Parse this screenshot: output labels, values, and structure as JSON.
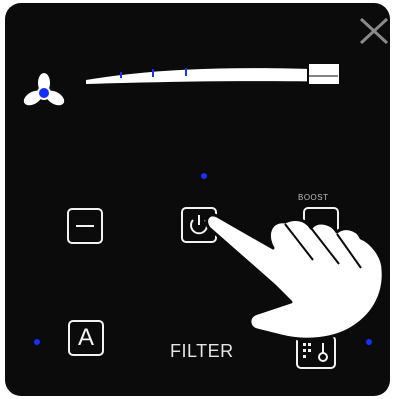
{
  "header": {
    "close_icon": "close-icon"
  },
  "fan": {
    "icon": "fan-icon",
    "center_color": "#1530ff"
  },
  "speed_slider": {
    "level_fraction": 0.3,
    "tick_color": "#1530ff"
  },
  "controls": {
    "minus_icon": "minus-icon",
    "power_icon": "power-icon",
    "boost_label": "BOOST",
    "auto_label": "A",
    "filter_label": "FILTER",
    "filter_icon": "filter-timer-icon"
  },
  "overlay": {
    "hand_icon": "pointing-hand-icon"
  },
  "colors": {
    "panel": "#0b0b0b",
    "foreground": "#f2f2f2",
    "accent_dot": "#1530ff"
  }
}
